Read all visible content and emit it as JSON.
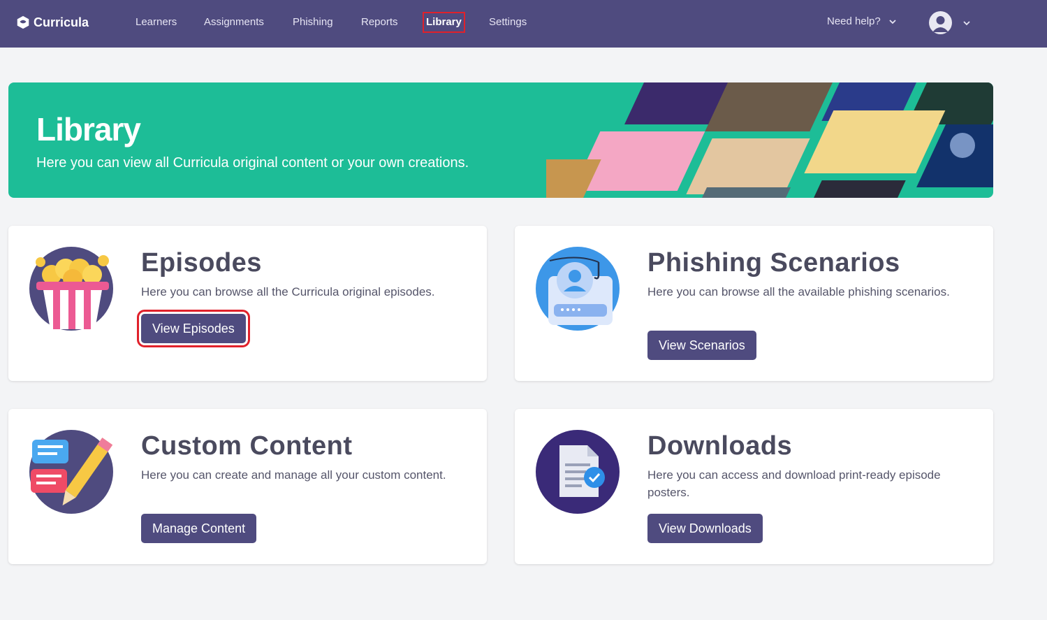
{
  "app": {
    "brand": "Curricula"
  },
  "nav": {
    "items": [
      {
        "label": "Learners"
      },
      {
        "label": "Assignments"
      },
      {
        "label": "Phishing"
      },
      {
        "label": "Reports"
      },
      {
        "label": "Library"
      },
      {
        "label": "Settings"
      }
    ],
    "active": "Library",
    "help_label": "Need help?"
  },
  "banner": {
    "title": "Library",
    "subtitle": "Here you can view all Curricula original content or your own creations."
  },
  "cards": [
    {
      "title": "Episodes",
      "description": "Here you can browse all the Curricula original episodes.",
      "button": "View Episodes",
      "icon": "popcorn-icon"
    },
    {
      "title": "Phishing Scenarios",
      "description": "Here you can browse all the available phishing scenarios.",
      "button": "View Scenarios",
      "icon": "phishing-hook-icon"
    },
    {
      "title": "Custom Content",
      "description": "Here you can create and manage all your custom content.",
      "button": "Manage Content",
      "icon": "pencil-chat-icon"
    },
    {
      "title": "Downloads",
      "description": "Here you can access and download print-ready episode posters.",
      "button": "View Downloads",
      "icon": "document-check-icon"
    }
  ],
  "colors": {
    "nav_bg": "#4f4b7f",
    "banner_bg": "#1dbd97",
    "button_bg": "#4f4b7f",
    "highlight": "#e0212b"
  }
}
